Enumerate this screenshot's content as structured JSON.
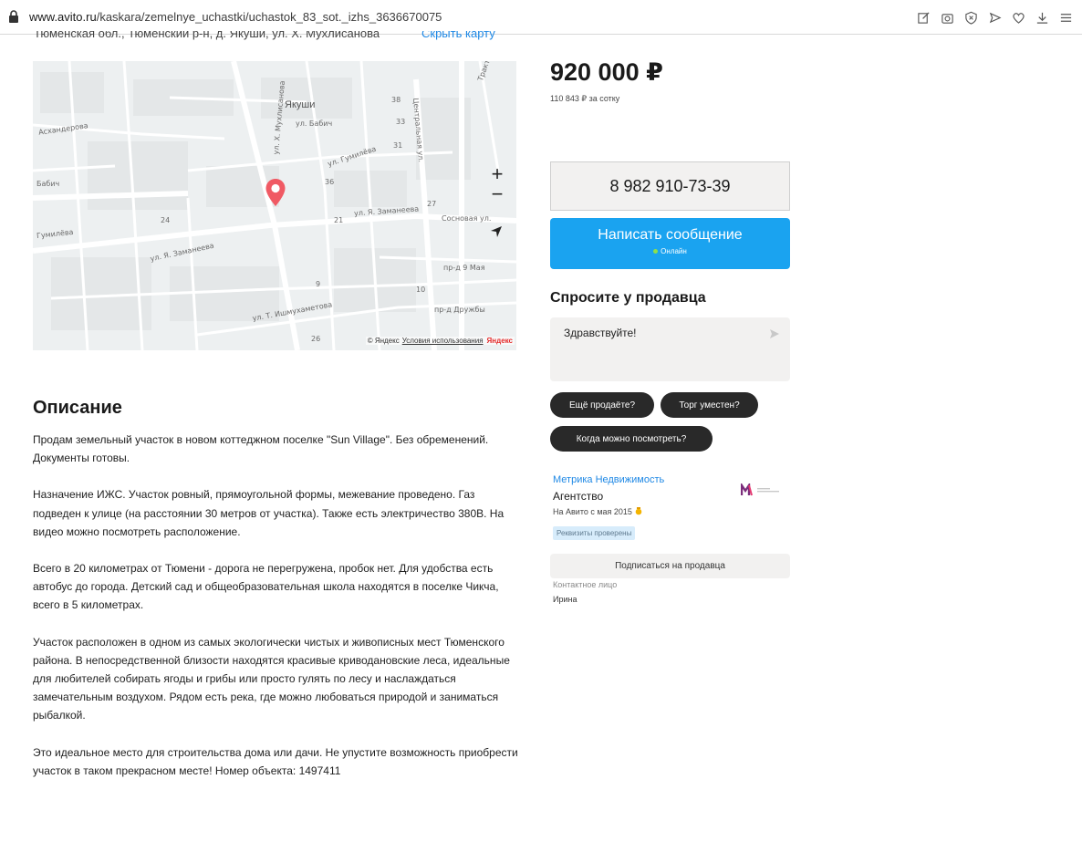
{
  "browser": {
    "url_host": "www.avito.ru",
    "url_path": "/kaskara/zemelnye_uchastki/uchastok_83_sot._izhs_3636670075",
    "toolbar_icons": [
      "edit-icon",
      "camera-icon",
      "shield-icon",
      "send-icon",
      "heart-icon",
      "download-icon",
      "menu-icon"
    ]
  },
  "listing": {
    "address_cut": "Тюменская обл., Тюменский р-н, д. Якуши, ул. Х. Мухлисанова",
    "hide_map": "Скрыть карту",
    "price": "920 000 ₽",
    "price_per": "110 843 ₽ за сотку"
  },
  "map": {
    "city": "Якуши",
    "streets": [
      "ул. Бабич",
      "ул. Х. Мухлисанова",
      "ул. Гумилёва",
      "ул. Я. Заманеева",
      "Сосновая ул.",
      "пр-д 9 Мая",
      "пр-д Дружбы",
      "ул. Т. Ишмухаметова",
      "Асхандерова",
      "Бабич",
      "Гумилёва",
      "ул. Я. Заманеева",
      "Центральная ул.",
      "Трактовая ул."
    ],
    "numbers": [
      "38",
      "33",
      "31",
      "36",
      "27",
      "24",
      "21",
      "9",
      "10",
      "26"
    ],
    "zoom_in": "+",
    "zoom_out": "−",
    "attribution": "© Яндекс",
    "terms": "Условия использования",
    "logo": "Яндекс"
  },
  "description": {
    "title": "Описание",
    "paragraphs": [
      "Продам земельный участок в новом коттеджном поселке \"Sun Village\". Без обременений. Документы готовы.",
      "Назначение ИЖС. Участок ровный, прямоугольной формы, межевание проведено. Газ подведен к улице (на расстоянии 30 метров от участка). Также есть электричество 380В. На видео можно посмотреть расположение.",
      "Всего в 20 километрах от Тюмени - дорога не перегружена, пробок нет. Для удобства есть автобус до города. Детский сад и общеобразовательная школа находятся в поселке Чикча, всего в 5 километрах.",
      "Участок расположен в одном из самых экологически чистых и живописных мест Тюменского района. В непосредственной близости находятся красивые криводановские леса, идеальные для любителей собирать ягоды и грибы или просто гулять по лесу и наслаждаться замечательным воздухом. Рядом есть река, где можно любоваться природой и заниматься рыбалкой.",
      "Это идеальное место для строительства дома или дачи. Не упустите возможность приобрести участок в таком прекрасном месте! Номер объекта: 1497411"
    ]
  },
  "contact": {
    "phone": "8 982 910-73-39",
    "message_button": "Написать сообщение",
    "online": "Онлайн",
    "ask_title": "Спросите у продавца",
    "ask_text": "Здравствуйте!",
    "chips": [
      "Ещё продаёте?",
      "Торг уместен?",
      "Когда можно посмотреть?"
    ],
    "seller_name": "Метрика Недвижимость",
    "seller_type": "Агентство",
    "since": "На Авито с мая 2015",
    "badge": "Реквизиты проверены",
    "subscribe": "Подписаться на продавца",
    "contact_label": "Контактное лицо",
    "contact_name": "Ирина"
  },
  "colors": {
    "accent": "#1aa3f0",
    "link": "#1e88e5",
    "pin": "#f05a64",
    "chip": "#292929"
  }
}
